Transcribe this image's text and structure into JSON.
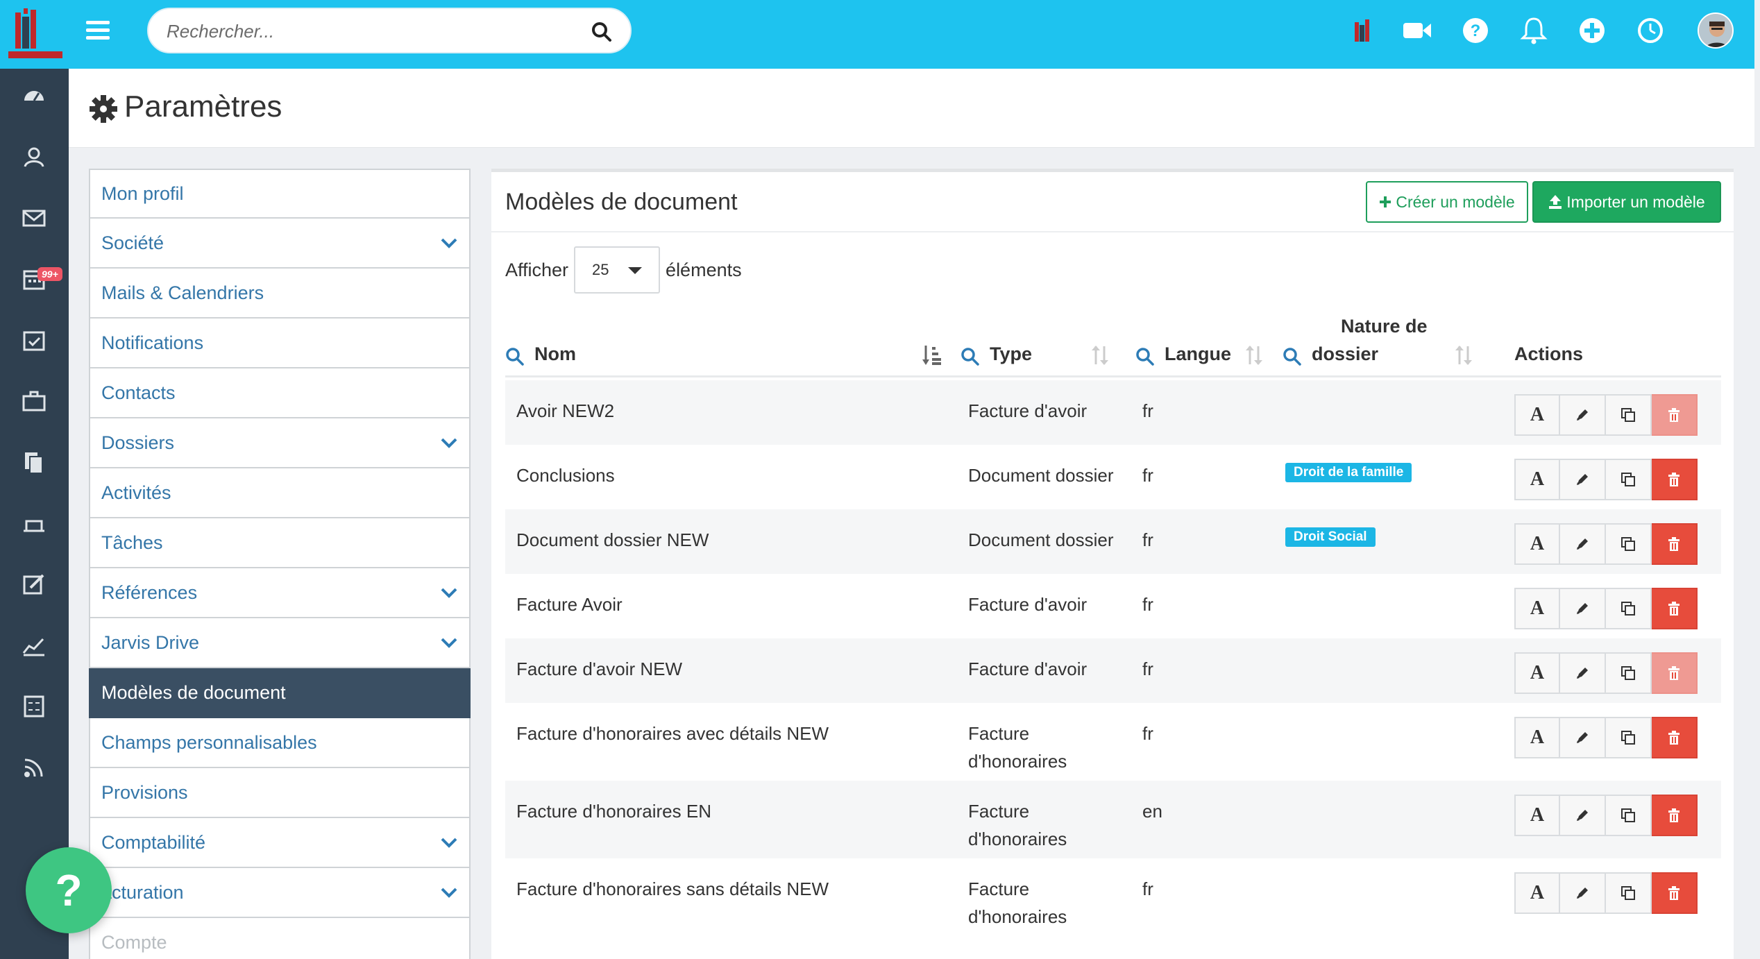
{
  "topbar": {
    "search_placeholder": "Rechercher...",
    "icons": [
      "menu-icon",
      "search-icon",
      "app-logo-icon",
      "video-icon",
      "help-icon",
      "bell-icon",
      "plus-circle-icon",
      "clock-icon",
      "user-avatar"
    ]
  },
  "sidebar": {
    "icons": [
      "dashboard-icon",
      "contacts-icon",
      "mail-icon",
      "calendar-icon",
      "tasks-icon",
      "briefcase-icon",
      "documents-icon",
      "billing-icon",
      "edit-icon",
      "stats-icon",
      "calculator-icon",
      "rss-icon"
    ],
    "mail_badge": "99+"
  },
  "page": {
    "title": "Paramètres"
  },
  "menu": {
    "items": [
      {
        "label": "Mon profil",
        "expandable": false
      },
      {
        "label": "Société",
        "expandable": true
      },
      {
        "label": "Mails & Calendriers",
        "expandable": false
      },
      {
        "label": "Notifications",
        "expandable": false
      },
      {
        "label": "Contacts",
        "expandable": false
      },
      {
        "label": "Dossiers",
        "expandable": true
      },
      {
        "label": "Activités",
        "expandable": false
      },
      {
        "label": "Tâches",
        "expandable": false
      },
      {
        "label": "Références",
        "expandable": true
      },
      {
        "label": "Jarvis Drive",
        "expandable": true
      },
      {
        "label": "Modèles de document",
        "expandable": false,
        "active": true
      },
      {
        "label": "Champs personnalisables",
        "expandable": false
      },
      {
        "label": "Provisions",
        "expandable": false
      },
      {
        "label": "Comptabilité",
        "expandable": true
      },
      {
        "label": "acturation",
        "expandable": true
      },
      {
        "label": "Compte",
        "expandable": false,
        "muted": true
      }
    ]
  },
  "help": {
    "label": "?"
  },
  "panel": {
    "title": "Modèles de document",
    "create_label": "Créer un modèle",
    "import_label": "Importer un modèle",
    "show_prefix": "Afficher",
    "page_size": "25",
    "show_suffix": "éléments"
  },
  "table": {
    "columns": {
      "name": "Nom",
      "type": "Type",
      "lang": "Langue",
      "nature_line1": "Nature de",
      "nature_line2": "dossier",
      "actions": "Actions"
    },
    "rows": [
      {
        "name": "Avoir NEW2",
        "type1": "Facture d'avoir",
        "type2": "",
        "lang": "fr",
        "nature": "",
        "delete_enabled": false
      },
      {
        "name": "Conclusions",
        "type1": "Document dossier",
        "type2": "",
        "lang": "fr",
        "nature": "Droit de la famille",
        "delete_enabled": true
      },
      {
        "name": "Document dossier NEW",
        "type1": "Document dossier",
        "type2": "",
        "lang": "fr",
        "nature": "Droit Social",
        "delete_enabled": true
      },
      {
        "name": "Facture Avoir",
        "type1": "Facture d'avoir",
        "type2": "",
        "lang": "fr",
        "nature": "",
        "delete_enabled": true
      },
      {
        "name": "Facture d'avoir NEW",
        "type1": "Facture d'avoir",
        "type2": "",
        "lang": "fr",
        "nature": "",
        "delete_enabled": false
      },
      {
        "name": "Facture d'honoraires avec détails NEW",
        "type1": "Facture",
        "type2": "d'honoraires",
        "lang": "fr",
        "nature": "",
        "delete_enabled": true
      },
      {
        "name": "Facture d'honoraires EN",
        "type1": "Facture",
        "type2": "d'honoraires",
        "lang": "en",
        "nature": "",
        "delete_enabled": true
      },
      {
        "name": "Facture d'honoraires sans détails NEW",
        "type1": "Facture",
        "type2": "d'honoraires",
        "lang": "fr",
        "nature": "",
        "delete_enabled": true
      }
    ],
    "action_text_label": "A"
  },
  "colors": {
    "topbar": "#1ec3ef",
    "sidenav": "#2f4050",
    "active_menu": "#3a4f63",
    "link": "#3476a8",
    "success": "#1ea85f",
    "danger": "#e74c3c",
    "tag": "#1cb6e5"
  }
}
